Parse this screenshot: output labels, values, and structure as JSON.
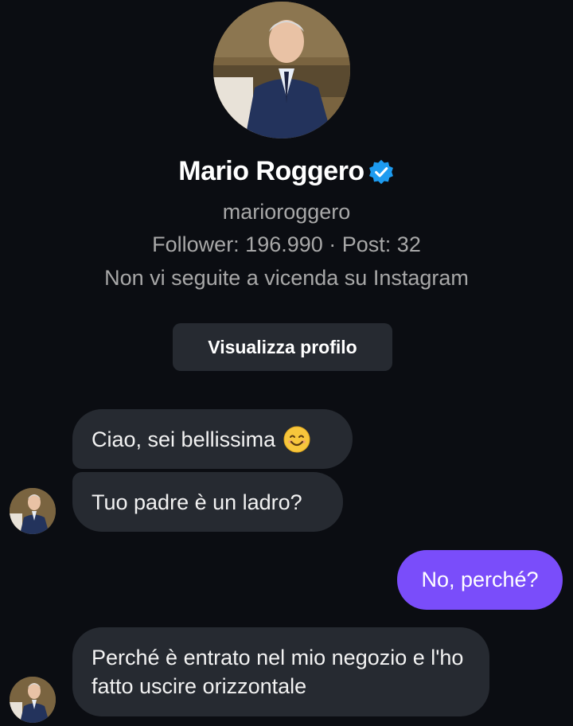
{
  "profile": {
    "name": "Mario Roggero",
    "username": "marioroggero",
    "stats": "Follower: 196.990 · Post: 32",
    "mutual_note": "Non vi seguite a vicenda su Instagram",
    "view_profile_label": "Visualizza profilo",
    "verified_color": "#1d9bf0"
  },
  "messages": [
    {
      "from": "them",
      "text": "Ciao, sei bellissima",
      "emoji": "smiling-face-icon"
    },
    {
      "from": "them",
      "text": "Tuo padre è un ladro?"
    },
    {
      "from": "me",
      "text": "No, perché?"
    },
    {
      "from": "them",
      "text": "Perché è entrato nel mio negozio e l'ho fatto uscire orizzontale"
    }
  ],
  "colors": {
    "background": "#0b0d12",
    "incoming_bubble": "#262a31",
    "outgoing_bubble": "#7a4dfa"
  }
}
